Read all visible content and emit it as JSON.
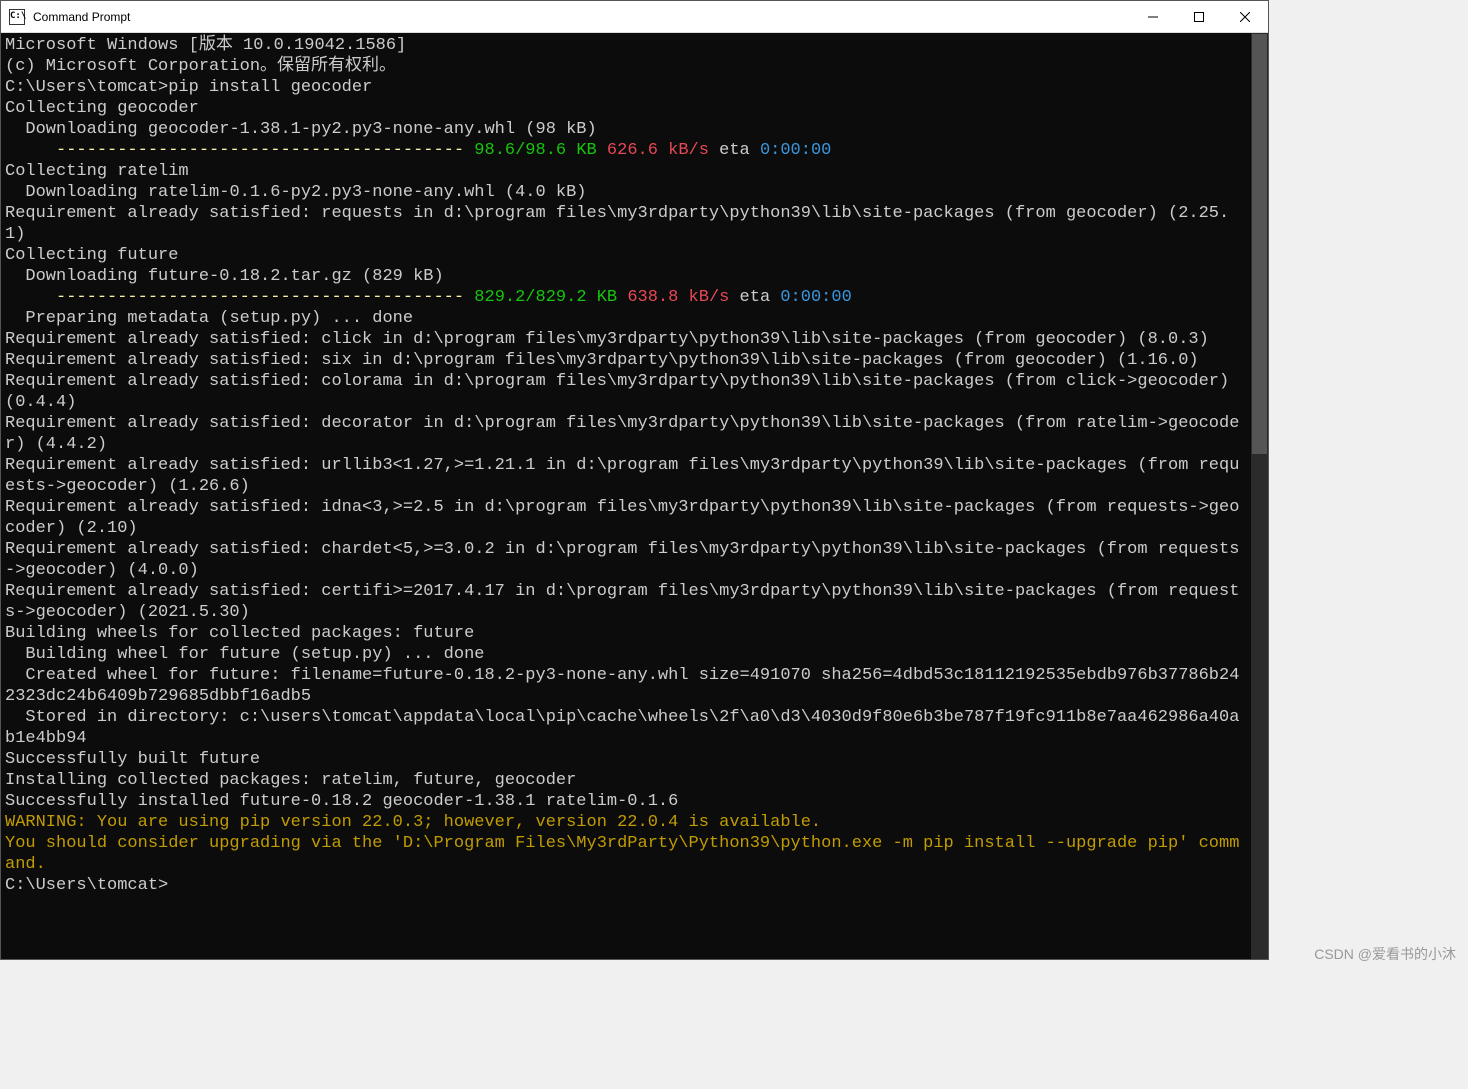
{
  "window": {
    "title": "Command Prompt",
    "icon_text": "C:\\"
  },
  "header_lines": [
    "Microsoft Windows [版本 10.0.19042.1586]",
    "(c) Microsoft Corporation。保留所有权利。",
    ""
  ],
  "prompt1_path": "C:\\Users\\tomcat>",
  "prompt1_cmd": "pip install geocoder",
  "body1": [
    "Collecting geocoder",
    "  Downloading geocoder-1.38.1-py2.py3-none-any.whl (98 kB)"
  ],
  "progress1": {
    "indent": "     ",
    "bar": "---------------------------------------- ",
    "size": "98.6/98.6 KB ",
    "speed": "626.6 kB/s ",
    "eta_lbl": "eta ",
    "eta": "0:00:00"
  },
  "body2": [
    "Collecting ratelim",
    "  Downloading ratelim-0.1.6-py2.py3-none-any.whl (4.0 kB)",
    "Requirement already satisfied: requests in d:\\program files\\my3rdparty\\python39\\lib\\site-packages (from geocoder) (2.25.1)",
    "Collecting future",
    "  Downloading future-0.18.2.tar.gz (829 kB)"
  ],
  "progress2": {
    "indent": "     ",
    "bar": "---------------------------------------- ",
    "size": "829.2/829.2 KB ",
    "speed": "638.8 kB/s ",
    "eta_lbl": "eta ",
    "eta": "0:00:00"
  },
  "body3": [
    "  Preparing metadata (setup.py) ... done",
    "Requirement already satisfied: click in d:\\program files\\my3rdparty\\python39\\lib\\site-packages (from geocoder) (8.0.3)",
    "Requirement already satisfied: six in d:\\program files\\my3rdparty\\python39\\lib\\site-packages (from geocoder) (1.16.0)",
    "Requirement already satisfied: colorama in d:\\program files\\my3rdparty\\python39\\lib\\site-packages (from click->geocoder) (0.4.4)",
    "Requirement already satisfied: decorator in d:\\program files\\my3rdparty\\python39\\lib\\site-packages (from ratelim->geocoder) (4.4.2)",
    "Requirement already satisfied: urllib3<1.27,>=1.21.1 in d:\\program files\\my3rdparty\\python39\\lib\\site-packages (from requests->geocoder) (1.26.6)",
    "Requirement already satisfied: idna<3,>=2.5 in d:\\program files\\my3rdparty\\python39\\lib\\site-packages (from requests->geocoder) (2.10)",
    "Requirement already satisfied: chardet<5,>=3.0.2 in d:\\program files\\my3rdparty\\python39\\lib\\site-packages (from requests->geocoder) (4.0.0)",
    "Requirement already satisfied: certifi>=2017.4.17 in d:\\program files\\my3rdparty\\python39\\lib\\site-packages (from requests->geocoder) (2021.5.30)",
    "Building wheels for collected packages: future",
    "  Building wheel for future (setup.py) ... done",
    "  Created wheel for future: filename=future-0.18.2-py3-none-any.whl size=491070 sha256=4dbd53c18112192535ebdb976b37786b242323dc24b6409b729685dbbf16adb5",
    "  Stored in directory: c:\\users\\tomcat\\appdata\\local\\pip\\cache\\wheels\\2f\\a0\\d3\\4030d9f80e6b3be787f19fc911b8e7aa462986a40ab1e4bb94",
    "Successfully built future",
    "Installing collected packages: ratelim, future, geocoder",
    "Successfully installed future-0.18.2 geocoder-1.38.1 ratelim-0.1.6"
  ],
  "warning": [
    "WARNING: You are using pip version 22.0.3; however, version 22.0.4 is available.",
    "You should consider upgrading via the 'D:\\Program Files\\My3rdParty\\Python39\\python.exe -m pip install --upgrade pip' command."
  ],
  "prompt2_path": "C:\\Users\\tomcat>",
  "watermark": "CSDN @爱看书的小沐"
}
